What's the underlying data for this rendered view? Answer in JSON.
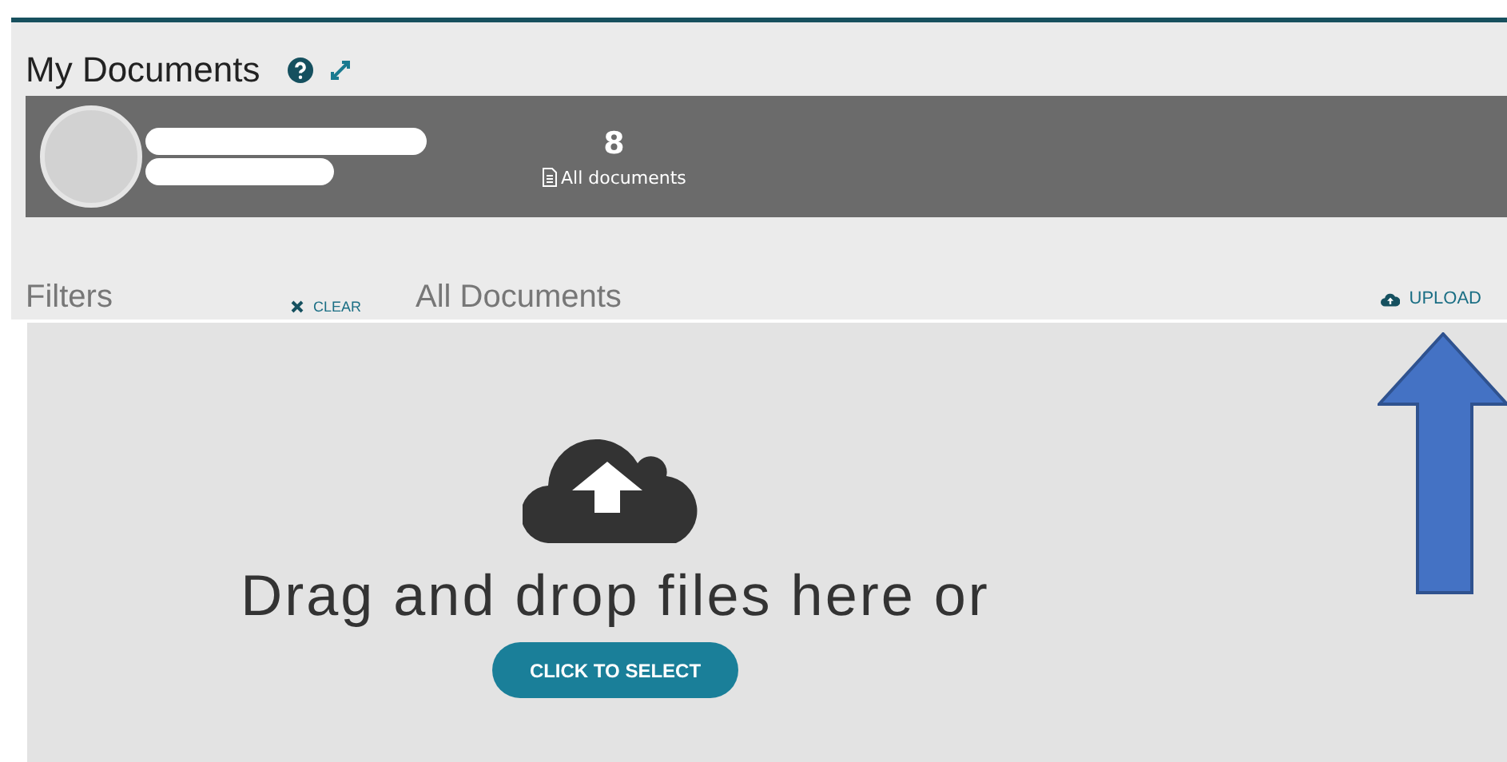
{
  "title": "My Documents",
  "profile": {
    "count": "8",
    "count_label": "All documents"
  },
  "filters": {
    "label": "Filters",
    "clear": "CLEAR"
  },
  "documents": {
    "heading": "All Documents",
    "upload": "UPLOAD"
  },
  "dropzone": {
    "text": "Drag and drop files here or",
    "button": "CLICK TO SELECT"
  }
}
